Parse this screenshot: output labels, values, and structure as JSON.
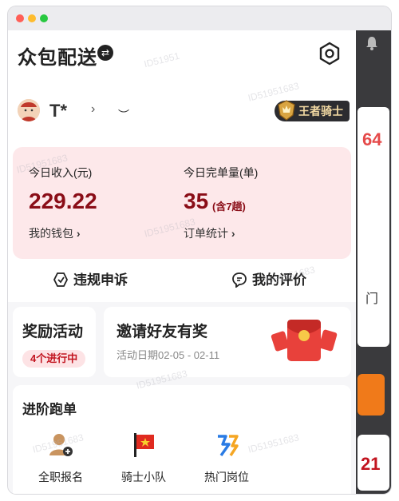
{
  "app": {
    "title": "众包配送"
  },
  "profile": {
    "name": "T*",
    "rank_badge": "王者骑士"
  },
  "stats": {
    "income_label": "今日收入(元)",
    "income_value": "229.22",
    "wallet_link": "我的钱包",
    "orders_label": "今日完单量(单)",
    "orders_value": "35",
    "orders_sub": "(含7趟)",
    "orders_link": "订单统计"
  },
  "actions": {
    "appeal": "违规申诉",
    "reviews": "我的评价"
  },
  "rewards": {
    "title": "奖励活动",
    "pill": "4个进行中"
  },
  "invite": {
    "title": "邀请好友有奖",
    "dates": "活动日期02-05 - 02-11"
  },
  "advanced": {
    "title": "进阶跑单",
    "items": [
      {
        "label": "全职报名",
        "icon": "person-add-icon"
      },
      {
        "label": "骑士小队",
        "icon": "red-flag-icon"
      },
      {
        "label": "热门岗位",
        "icon": "hot-job-icon"
      }
    ]
  },
  "background": {
    "number_top": "64",
    "text_mid": "门",
    "number_bottom": "21"
  },
  "colors": {
    "accent": "#8a0d17",
    "stats_bg": "#fde8ea",
    "badge_bg": "#2c2c30"
  }
}
